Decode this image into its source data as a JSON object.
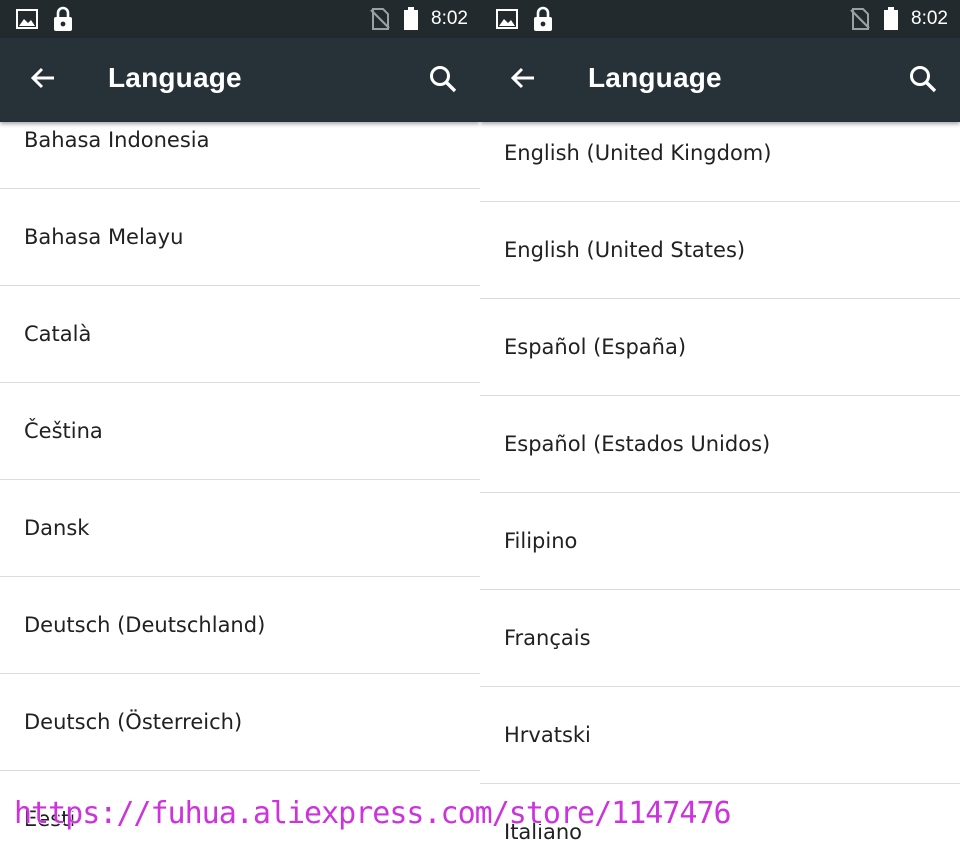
{
  "status": {
    "time": "8:02"
  },
  "left_panel": {
    "title": "Language",
    "items": [
      "Bahasa Indonesia",
      "Bahasa Melayu",
      "Català",
      "Čeština",
      "Dansk",
      "Deutsch (Deutschland)",
      "Deutsch (Österreich)",
      "Eesti"
    ]
  },
  "right_panel": {
    "title": "Language",
    "items": [
      "English (United Kingdom)",
      "English (United States)",
      "Español (España)",
      "Español (Estados Unidos)",
      "Filipino",
      "Français",
      "Hrvatski",
      "Italiano"
    ]
  },
  "icons": {
    "gallery": "image-icon",
    "lock": "lock-icon",
    "no_sim": "no-sim-icon",
    "battery": "battery-icon",
    "back": "arrow-back-icon",
    "search": "search-icon"
  },
  "colors": {
    "toolbar": "#263238",
    "statusbar": "#222a2e",
    "watermark": "#cc33dd"
  },
  "watermark": "https://fuhua.aliexpress.com/store/1147476"
}
